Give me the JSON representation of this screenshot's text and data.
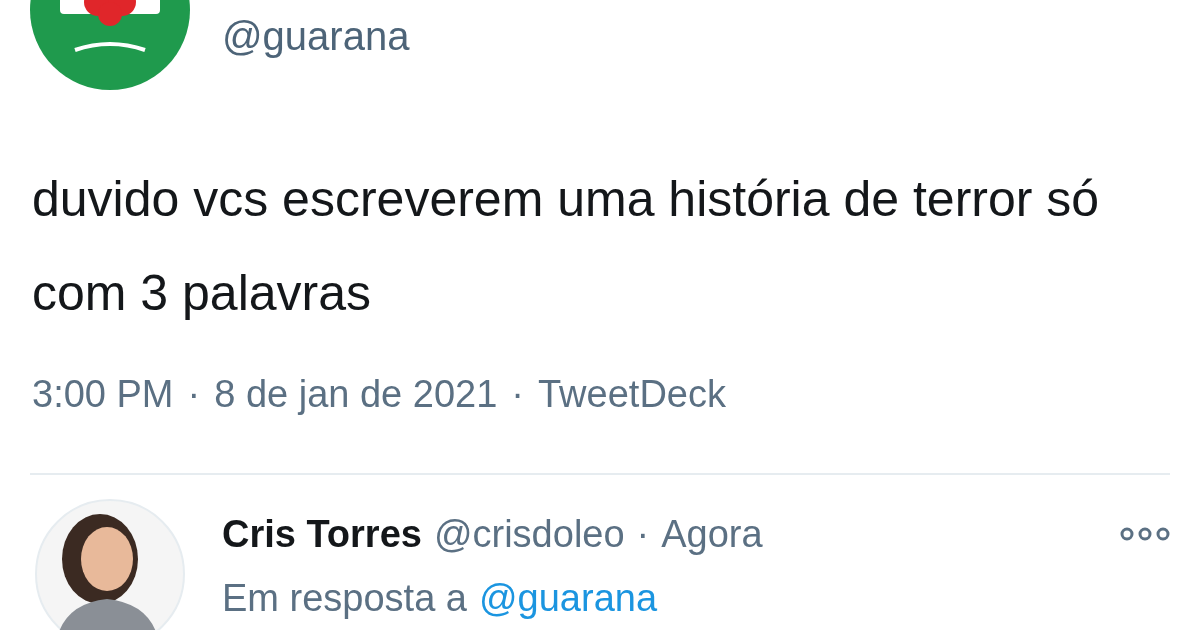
{
  "tweet": {
    "handle": "@guarana",
    "text": "duvido vcs escreverem uma história de terror só com 3 palavras",
    "time": "3:00 PM",
    "separator_1": "·",
    "date": "8 de jan de 2021",
    "separator_2": "·",
    "source": "TweetDeck"
  },
  "reply": {
    "name": "Cris Torres",
    "handle": "@crisdoleo",
    "separator": "·",
    "time": "Agora",
    "reply_prefix": "Em resposta a",
    "reply_to": "@guarana"
  }
}
